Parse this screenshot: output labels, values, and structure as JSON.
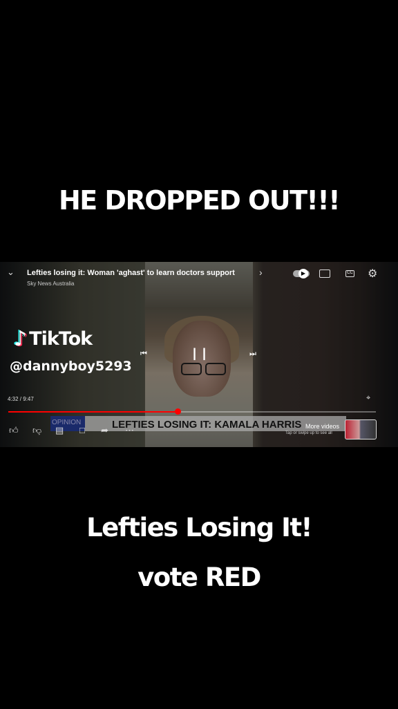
{
  "captions": {
    "top": "HE DROPPED OUT!!!",
    "middle": "Lefties Losing It!",
    "bottom": "vote RED"
  },
  "tiktok": {
    "brand": "TikTok",
    "username": "@dannyboy5293"
  },
  "player": {
    "title": "Lefties losing it: Woman 'aghast' to learn doctors support",
    "channel": "Sky News Australia",
    "current_time": "4:32",
    "duration": "9:47",
    "time_display": "4:32 / 9:47",
    "progress_fraction": 0.46,
    "lower_third_tag": "OPINION",
    "lower_third_headline": "LEFTIES LOSING IT: KAMALA HARRIS",
    "more_videos": "More videos",
    "more_videos_hint": "Tap or swipe up to see all",
    "cc_label": "CC",
    "accent": "#ff0000"
  }
}
